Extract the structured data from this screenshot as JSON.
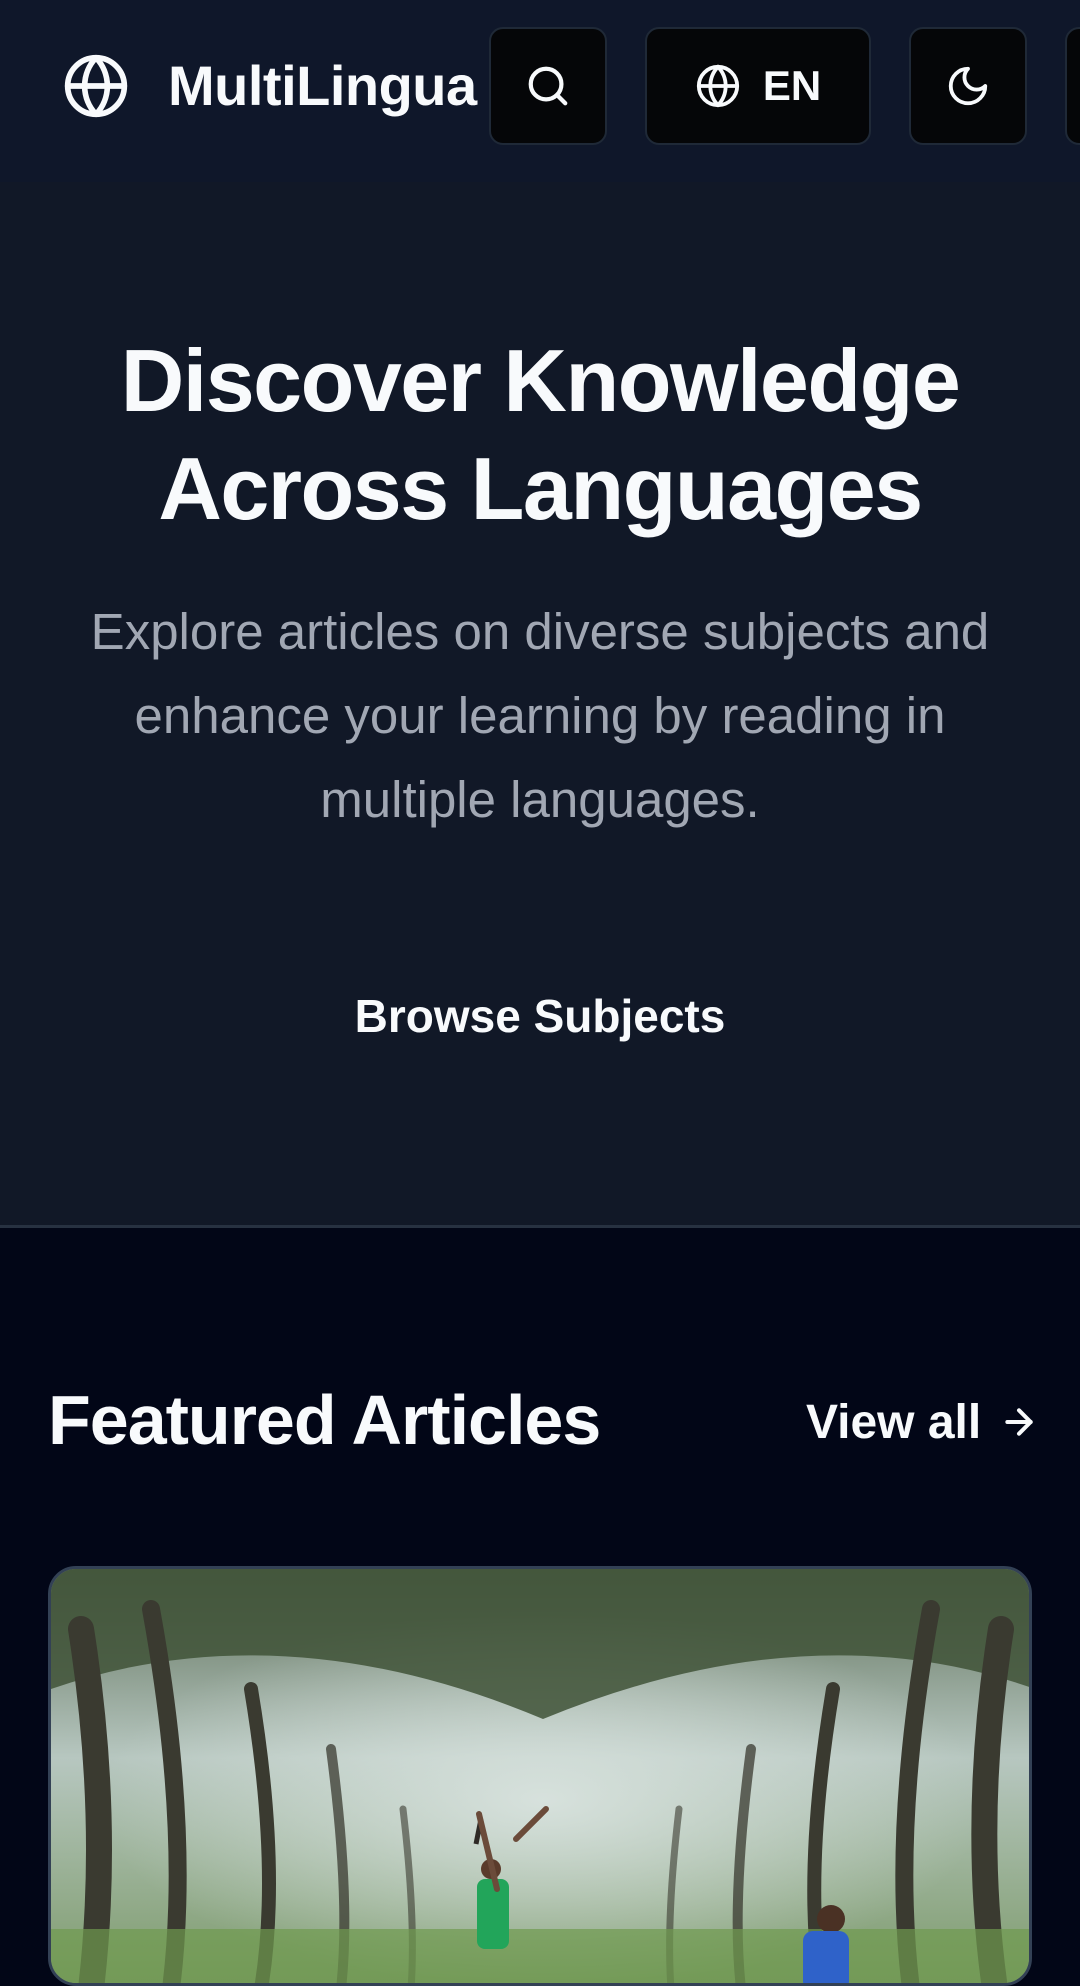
{
  "header": {
    "brand": "MultiLingua",
    "language_code": "EN",
    "icons": {
      "logo": "globe-icon",
      "search": "search-icon",
      "language": "globe-icon",
      "theme": "moon-icon"
    }
  },
  "hero": {
    "title_line1": "Discover Knowledge",
    "title_line2": "Across Languages",
    "subtitle": "Explore articles on diverse subjects and enhance your learning by reading in multiple languages.",
    "cta_label": "Browse Subjects"
  },
  "featured": {
    "title": "Featured Articles",
    "view_all_label": "View all",
    "view_all_icon": "arrow-right-icon"
  },
  "colors": {
    "header_bg": "#0f172a",
    "hero_bg": "#111827",
    "page_bg": "#020617",
    "text_primary": "#f8fafc",
    "text_muted": "#a1a7b3"
  }
}
